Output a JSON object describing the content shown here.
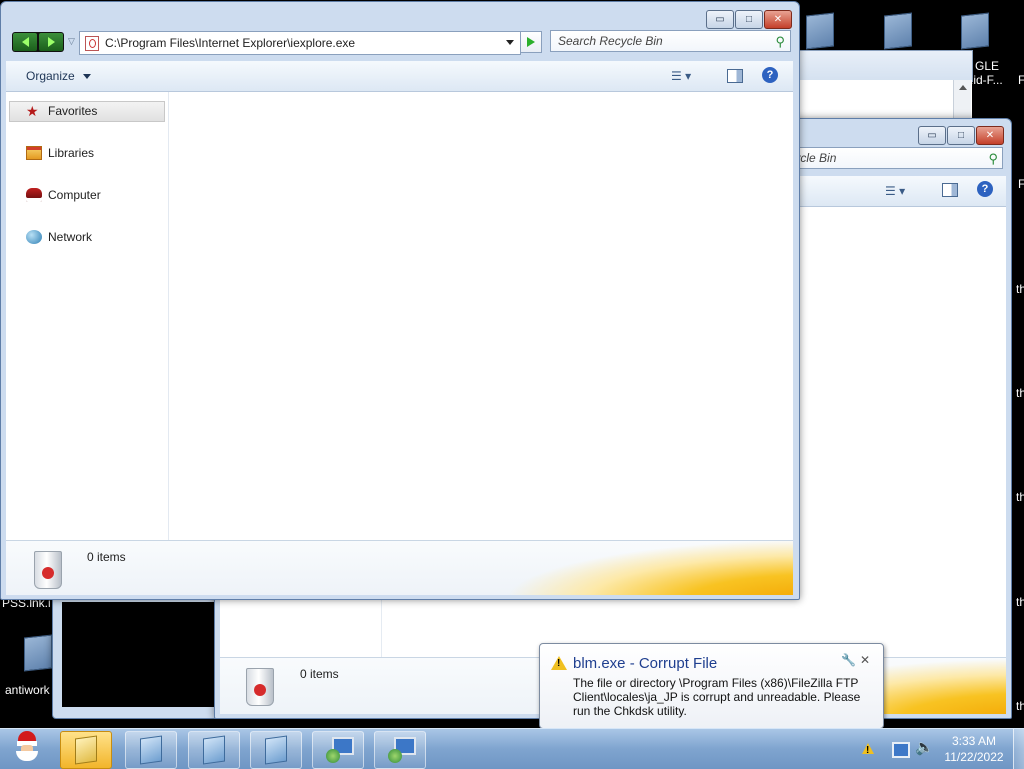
{
  "desktop": {
    "label_gle": "GLE",
    "label_id": ".id-F...",
    "label_pss": "PSS.lnk.i",
    "label_antiwork": "antiwork",
    "edge_f1": "F",
    "edge_f2": "F",
    "edge_th": "th"
  },
  "front_window": {
    "address": "C:\\Program Files\\Internet Explorer\\iexplore.exe",
    "search_placeholder": "Search Recycle Bin",
    "organize_label": "Organize",
    "nav": {
      "favorites": "Favorites",
      "libraries": "Libraries",
      "computer": "Computer",
      "network": "Network"
    },
    "status": "0 items",
    "caption": {
      "minimize": "▭",
      "maximize": "□",
      "close": "✕"
    }
  },
  "back_window": {
    "search_placeholder": "h Recycle Bin",
    "status": "0 items"
  },
  "balloon": {
    "title": "blm.exe - Corrupt File",
    "message": "The file or directory \\Program Files (x86)\\FileZilla FTP Client\\locales\\ja_JP is corrupt and unreadable. Please run the Chkdsk utility.",
    "close_glyph": "✕"
  },
  "taskbar": {
    "time": "3:33 AM",
    "date": "11/22/2022"
  },
  "colors": {
    "accent": "#1f3f8f",
    "taskbar": "#7fa4cf",
    "close": "#c4402a"
  }
}
